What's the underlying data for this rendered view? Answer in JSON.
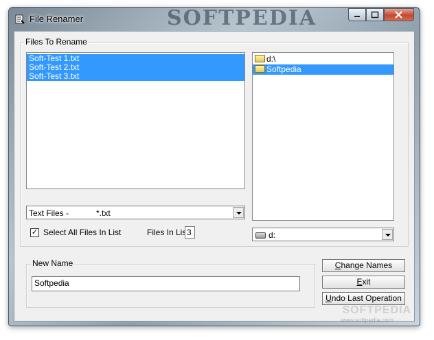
{
  "window": {
    "title": "File Renamer",
    "brand_watermark": "SOFTPEDIA"
  },
  "title_buttons": {
    "minimize": "–",
    "maximize": "□",
    "close": "✕"
  },
  "files_group": {
    "label": "Files To Rename",
    "files": [
      "Soft-Test 1.txt",
      "Soft-Test 2.txt",
      "Soft-Test 3.txt"
    ],
    "filter_value": "Text Files -            *.txt",
    "select_all_label": "Select All Files In List",
    "select_all_checked": true,
    "files_in_list_label": "Files In List:",
    "files_in_list_count": "3"
  },
  "folder_tree": {
    "items": [
      {
        "label": "d:\\",
        "selected": false
      },
      {
        "label": "Softpedia",
        "selected": true
      }
    ],
    "drive_value": "d:"
  },
  "new_name_group": {
    "label": "New Name",
    "value": "Softpedia"
  },
  "buttons": {
    "change_names_prefix": "",
    "change_names_u": "C",
    "change_names_rest": "hange Names",
    "exit_prefix": "",
    "exit_u": "E",
    "exit_rest": "xit",
    "undo_prefix": "",
    "undo_u": "U",
    "undo_rest": "ndo Last Operation"
  },
  "footer_watermark": {
    "brand": "SOFTPEDIA",
    "url": "www.softpedia.com"
  }
}
